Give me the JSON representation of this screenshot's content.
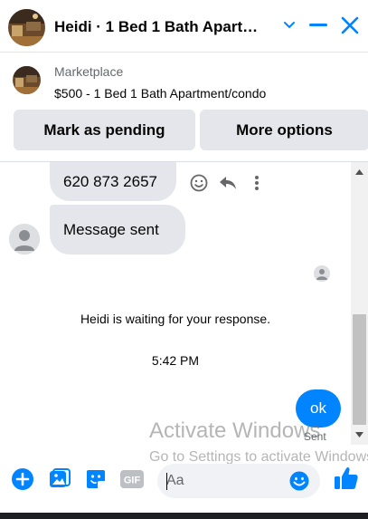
{
  "header": {
    "title": "Heidi · 1 Bed 1 Bath Apartment/condo"
  },
  "marketplace": {
    "label": "Marketplace",
    "listing": "$500 - 1 Bed 1 Bath Apartment/condo",
    "buttons": {
      "mark_pending": "Mark as pending",
      "more_options": "More options"
    }
  },
  "chat": {
    "messages": [
      {
        "text": "620 873 2657"
      },
      {
        "text": "Message sent"
      }
    ],
    "waiting_notice": "Heidi is waiting for your response.",
    "timestamp": "5:42 PM",
    "own_message": "ok",
    "status": "Sent"
  },
  "watermark": {
    "line1": "Activate Windows",
    "line2": "Go to Settings to activate Windows."
  },
  "composer": {
    "placeholder": "Aa",
    "gif_label": "GIF"
  },
  "colors": {
    "accent": "#0084ff",
    "bubble_gray": "#e4e6eb"
  }
}
